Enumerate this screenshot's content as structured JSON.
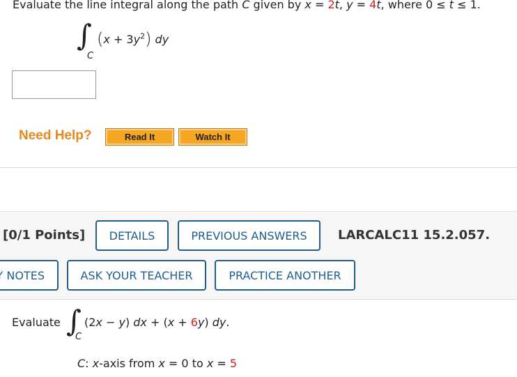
{
  "problem1": {
    "statement_prefix": "Evaluate the line integral along the path ",
    "path_var": "C",
    "given_by": " given by ",
    "x_var": "x",
    "eq1": " = ",
    "x_coef": "2",
    "t1": "t",
    "sep": ", ",
    "y_var": "y",
    "eq2": " = ",
    "y_coef": "4",
    "t2": "t",
    "where": ", where 0 ≤ ",
    "t3": "t",
    "range_end": " ≤ 1.",
    "integral_symbol": "∫",
    "subscript": "C",
    "open_paren": "(",
    "expr_x": "x",
    "expr_plus": " + 3",
    "expr_y": "y",
    "expr_exp": "2",
    "close_paren": ")",
    "differential": "dy",
    "answer_value": ""
  },
  "help": {
    "label": "Need Help?",
    "read_it": "Read It",
    "watch_it": "Watch It"
  },
  "problem2": {
    "points": "[0/1 Points]",
    "details": "DETAILS",
    "previous_answers": "PREVIOUS ANSWERS",
    "code": "LARCALC11 15.2.057.",
    "notes": "Y NOTES",
    "ask_teacher": "ASK YOUR TEACHER",
    "practice_another": "PRACTICE ANOTHER",
    "evaluate_label": "Evaluate",
    "integral_symbol": "∫",
    "subscript": "C",
    "expr_a": "(2",
    "expr_x1": "x",
    "expr_minus": " − ",
    "expr_y1": "y",
    "expr_b": ") ",
    "expr_dx": "dx",
    "expr_c": " + (",
    "expr_x2": "x",
    "expr_d": " + ",
    "expr_coef": "6",
    "expr_y2": "y",
    "expr_e": ") ",
    "expr_dy": "dy",
    "expr_end": ".",
    "path_c": "C",
    "path_colon": ": ",
    "path_x1": "x",
    "path_text": "-axis from ",
    "path_x2": "x",
    "path_eq1": " = 0 to ",
    "path_x3": "x",
    "path_eq2": " = ",
    "path_end_value": "5"
  },
  "colors": {
    "accent_red": "#cc2222",
    "help_orange": "#e8871e",
    "button_blue": "#1f5d8c",
    "button_orange": "#f5a623"
  }
}
